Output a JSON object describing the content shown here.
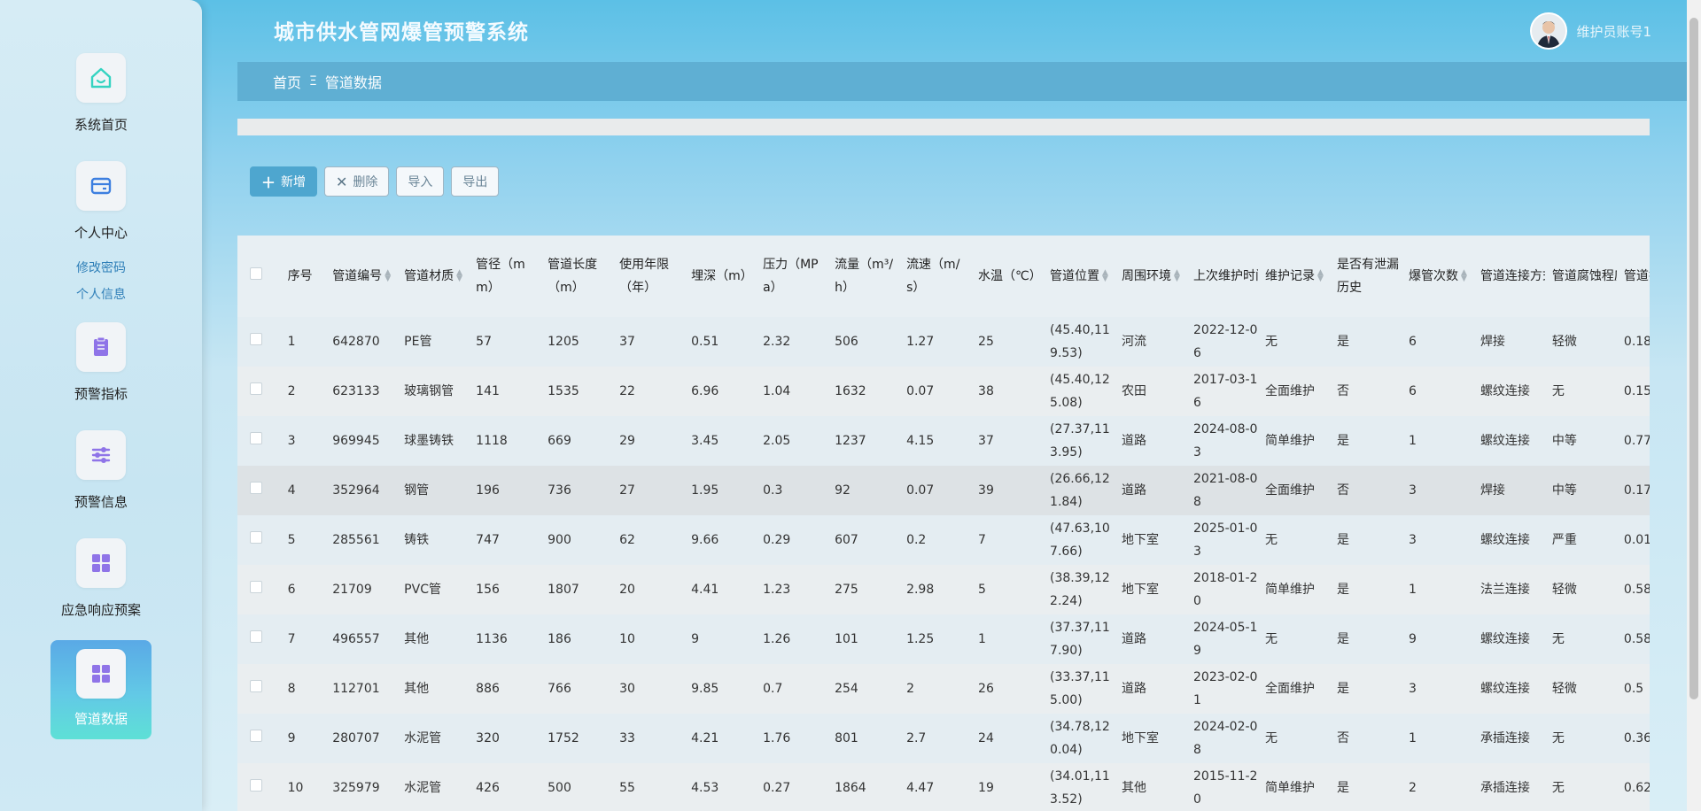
{
  "app": {
    "title": "城市供水管网爆管预警系统",
    "user_name": "维护员账号1"
  },
  "sidebar": {
    "items": [
      {
        "label": "系统首页",
        "icon": "home-icon"
      },
      {
        "label": "个人中心",
        "icon": "wallet-icon"
      },
      {
        "label": "预警指标",
        "icon": "clipboard-icon"
      },
      {
        "label": "预警信息",
        "icon": "sliders-icon"
      },
      {
        "label": "应急响应预案",
        "icon": "grid-icon"
      },
      {
        "label": "管道数据",
        "icon": "grid-icon"
      }
    ],
    "sub_links": [
      "修改密码",
      "个人信息"
    ]
  },
  "breadcrumb": {
    "home": "首页",
    "separator": "Ξ",
    "current": "管道数据"
  },
  "toolbar": {
    "add": "新增",
    "delete": "删除",
    "import": "导入",
    "export": "导出"
  },
  "table": {
    "headers": [
      "序号",
      "管道编号",
      "管道材质",
      "管径（mm）",
      "管道长度（m）",
      "使用年限（年）",
      "埋深（m）",
      "压力（MPa）",
      "流量（m³/h）",
      "流速（m/s）",
      "水温（℃）",
      "管道位置",
      "周围环境",
      "上次维护时间",
      "维护记录",
      "是否有泄漏历史",
      "爆管次数",
      "管道连接方式",
      "管道腐蚀程度",
      "管道振动"
    ],
    "rows": [
      [
        "1",
        "642870",
        "PE管",
        "57",
        "1205",
        "37",
        "0.51",
        "2.32",
        "506",
        "1.27",
        "25",
        "(45.40,119.53)",
        "河流",
        "2022-12-06",
        "无",
        "是",
        "6",
        "焊接",
        "轻微",
        "0.18"
      ],
      [
        "2",
        "623133",
        "玻璃钢管",
        "141",
        "1535",
        "22",
        "6.96",
        "1.04",
        "1632",
        "0.07",
        "38",
        "(45.40,125.08)",
        "农田",
        "2017-03-16",
        "全面维护",
        "否",
        "6",
        "螺纹连接",
        "无",
        "0.15"
      ],
      [
        "3",
        "969945",
        "球墨铸铁",
        "1118",
        "669",
        "29",
        "3.45",
        "2.05",
        "1237",
        "4.15",
        "37",
        "(27.37,113.95)",
        "道路",
        "2024-08-03",
        "简单维护",
        "是",
        "1",
        "螺纹连接",
        "中等",
        "0.77"
      ],
      [
        "4",
        "352964",
        "钢管",
        "196",
        "736",
        "27",
        "1.95",
        "0.3",
        "92",
        "0.07",
        "39",
        "(26.66,121.84)",
        "道路",
        "2021-08-08",
        "全面维护",
        "否",
        "3",
        "焊接",
        "中等",
        "0.17"
      ],
      [
        "5",
        "285561",
        "铸铁",
        "747",
        "900",
        "62",
        "9.66",
        "0.29",
        "607",
        "0.2",
        "7",
        "(47.63,107.66)",
        "地下室",
        "2025-01-03",
        "无",
        "是",
        "3",
        "螺纹连接",
        "严重",
        "0.01"
      ],
      [
        "6",
        "21709",
        "PVC管",
        "156",
        "1807",
        "20",
        "4.41",
        "1.23",
        "275",
        "2.98",
        "5",
        "(38.39,122.24)",
        "地下室",
        "2018-01-20",
        "简单维护",
        "是",
        "1",
        "法兰连接",
        "轻微",
        "0.58"
      ],
      [
        "7",
        "496557",
        "其他",
        "1136",
        "186",
        "10",
        "9",
        "1.26",
        "101",
        "1.25",
        "1",
        "(37.37,117.90)",
        "道路",
        "2024-05-19",
        "无",
        "是",
        "9",
        "螺纹连接",
        "无",
        "0.58"
      ],
      [
        "8",
        "112701",
        "其他",
        "886",
        "766",
        "30",
        "9.85",
        "0.7",
        "254",
        "2",
        "26",
        "(33.37,115.00)",
        "道路",
        "2023-02-01",
        "全面维护",
        "是",
        "3",
        "螺纹连接",
        "轻微",
        "0.5"
      ],
      [
        "9",
        "280707",
        "水泥管",
        "320",
        "1752",
        "33",
        "4.21",
        "1.76",
        "801",
        "2.7",
        "24",
        "(34.78,120.04)",
        "地下室",
        "2024-02-08",
        "无",
        "否",
        "1",
        "承插连接",
        "无",
        "0.36"
      ],
      [
        "10",
        "325979",
        "水泥管",
        "426",
        "500",
        "55",
        "4.53",
        "0.27",
        "1864",
        "4.47",
        "19",
        "(34.01,113.52)",
        "其他",
        "2015-11-20",
        "简单维护",
        "是",
        "2",
        "承插连接",
        "无",
        "0.62"
      ]
    ]
  }
}
